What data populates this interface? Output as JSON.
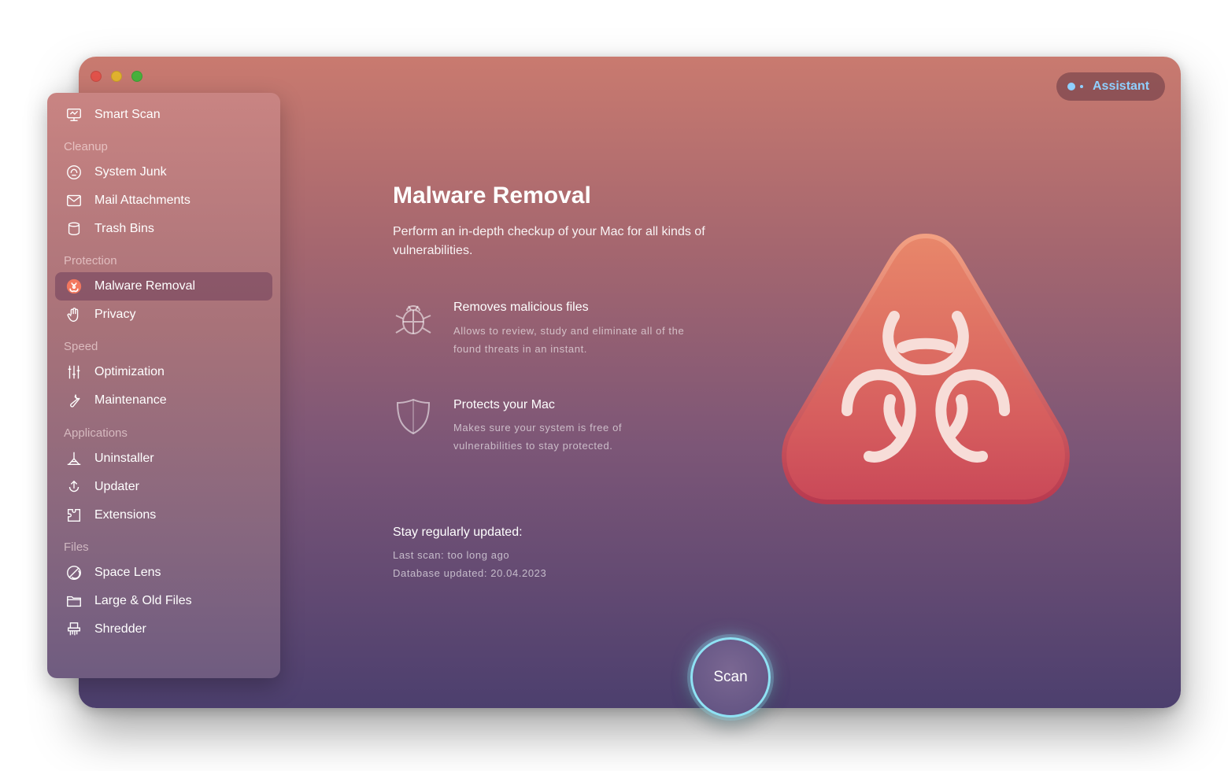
{
  "assistant": {
    "label": "Assistant"
  },
  "sidebar": {
    "smart_scan": "Smart Scan",
    "sections": {
      "cleanup": "Cleanup",
      "protection": "Protection",
      "speed": "Speed",
      "applications": "Applications",
      "files": "Files"
    },
    "items": {
      "system_junk": "System Junk",
      "mail_attachments": "Mail Attachments",
      "trash_bins": "Trash Bins",
      "malware_removal": "Malware Removal",
      "privacy": "Privacy",
      "optimization": "Optimization",
      "maintenance": "Maintenance",
      "uninstaller": "Uninstaller",
      "updater": "Updater",
      "extensions": "Extensions",
      "space_lens": "Space Lens",
      "large_old_files": "Large & Old Files",
      "shredder": "Shredder"
    },
    "active_item": "malware_removal"
  },
  "main": {
    "title": "Malware Removal",
    "description": "Perform an in-depth checkup of your Mac for all kinds of vulnerabilities.",
    "features": [
      {
        "title": "Removes malicious files",
        "line1": "Allows to review, study and eliminate all of the",
        "line2": "found threats in an instant.",
        "icon": "bug-icon"
      },
      {
        "title": "Protects your Mac",
        "line1": "Makes sure your system is free of",
        "line2": "vulnerabilities to stay protected.",
        "icon": "shield-icon"
      }
    ],
    "update": {
      "title": "Stay regularly updated:",
      "last_scan": "Last scan: too long ago",
      "database": "Database updated: 20.04.2023"
    },
    "scan_button": "Scan"
  },
  "colors": {
    "accent_cyan": "#8fe2f4",
    "assistant_blue": "#8fd0ff",
    "hero_top": "#e8876a",
    "hero_bottom": "#c94858"
  }
}
